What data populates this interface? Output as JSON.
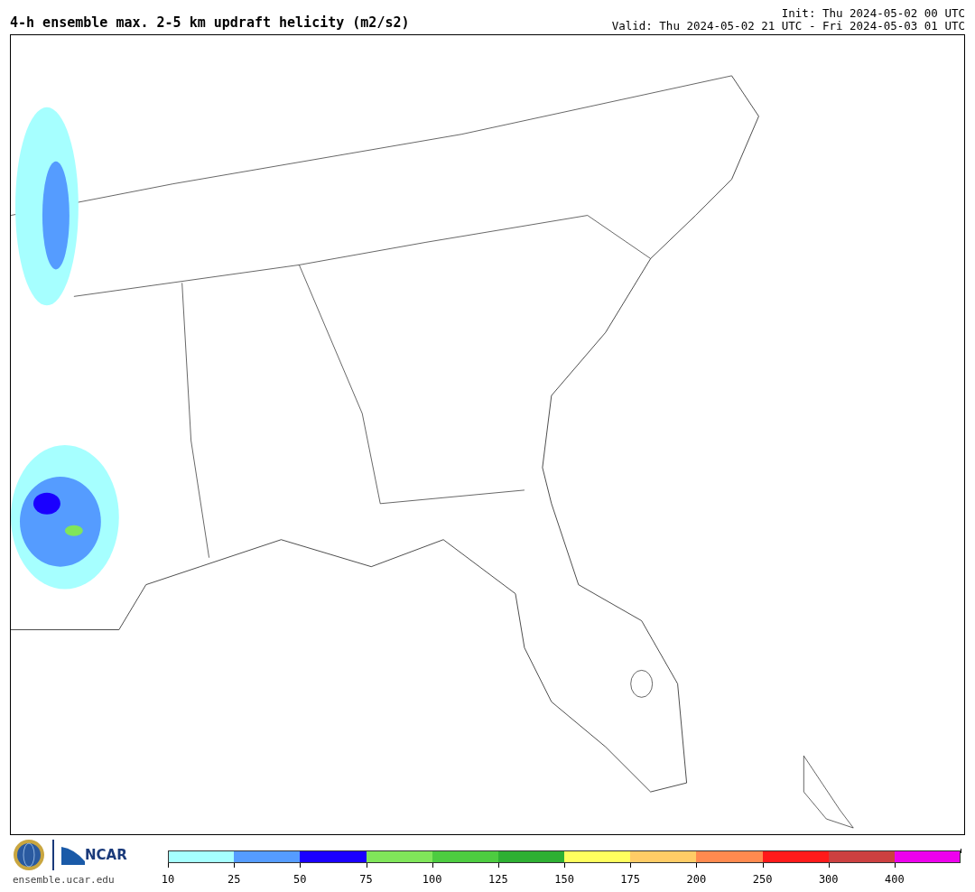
{
  "header": {
    "title": "4-h ensemble max. 2-5 km updraft helicity (m2/s2)",
    "init": "Init: Thu 2024-05-02 00 UTC",
    "valid": "Valid: Thu 2024-05-02 21 UTC - Fri 2024-05-03 01 UTC"
  },
  "footer": {
    "logo_text": "NCAR",
    "url": "ensemble.ucar.edu"
  },
  "colorbar": [
    {
      "color": "#a6ffff",
      "label": "10"
    },
    {
      "color": "#559cff",
      "label": "25"
    },
    {
      "color": "#1a00ff",
      "label": "50"
    },
    {
      "color": "#80e65a",
      "label": "75"
    },
    {
      "color": "#4dcc40",
      "label": "100"
    },
    {
      "color": "#2eb033",
      "label": "125"
    },
    {
      "color": "#ffff5e",
      "label": "150"
    },
    {
      "color": "#ffcc66",
      "label": "175"
    },
    {
      "color": "#ff8a4f",
      "label": "200"
    },
    {
      "color": "#ff1a1a",
      "label": "250"
    },
    {
      "color": "#cc4040",
      "label": "300"
    },
    {
      "color": "#ee00ee",
      "label": "400"
    }
  ]
}
